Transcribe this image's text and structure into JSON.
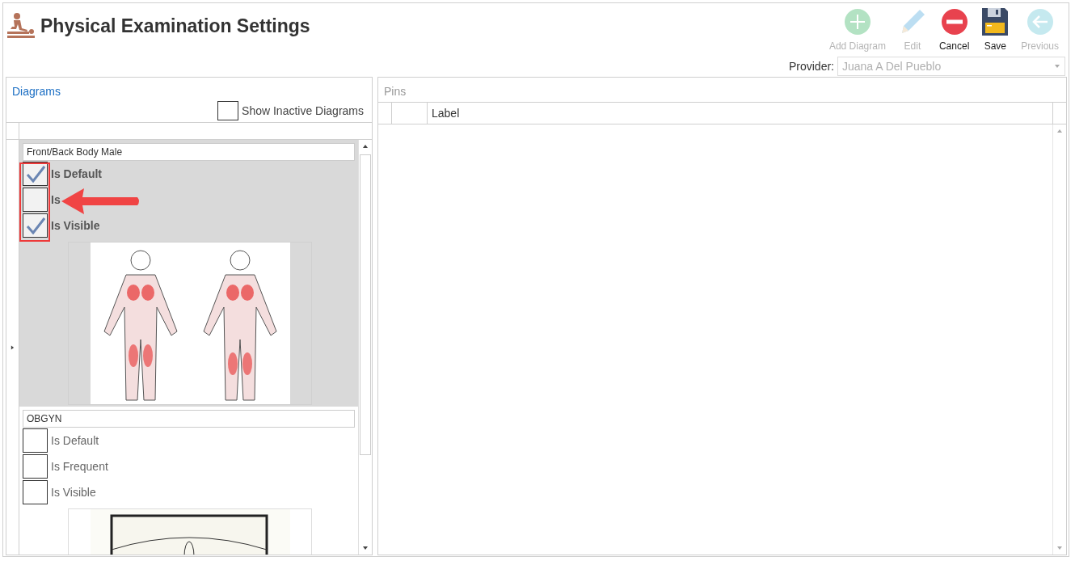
{
  "window": {
    "title": "Physical Examination Settings"
  },
  "toolbar": [
    {
      "label": "Add Diagram",
      "kind": "add",
      "disabled": true
    },
    {
      "label": "Edit",
      "kind": "edit",
      "disabled": true
    },
    {
      "label": "Cancel",
      "kind": "cancel",
      "disabled": false
    },
    {
      "label": "Save",
      "kind": "save",
      "disabled": false
    },
    {
      "label": "Previous",
      "kind": "previous",
      "disabled": true
    }
  ],
  "provider": {
    "label": "Provider:",
    "value": "Juana A Del Pueblo",
    "disabled": true
  },
  "diagrams_panel": {
    "title": "Diagrams",
    "show_inactive": {
      "label": "Show Inactive Diagrams",
      "checked": false
    },
    "rows": [
      {
        "name": "Front/Back Body Male",
        "selected": true,
        "flags": [
          {
            "label": "Is Default",
            "checked": true
          },
          {
            "label": "Is",
            "checked": false
          },
          {
            "label": "Is Visible",
            "checked": true
          }
        ]
      },
      {
        "name": "OBGYN",
        "selected": false,
        "flags": [
          {
            "label": "Is Default",
            "checked": false
          },
          {
            "label": "Is Frequent",
            "checked": false
          },
          {
            "label": "Is Visible",
            "checked": false
          }
        ]
      }
    ]
  },
  "pins_panel": {
    "title": "Pins",
    "columns": [
      "Label"
    ]
  }
}
